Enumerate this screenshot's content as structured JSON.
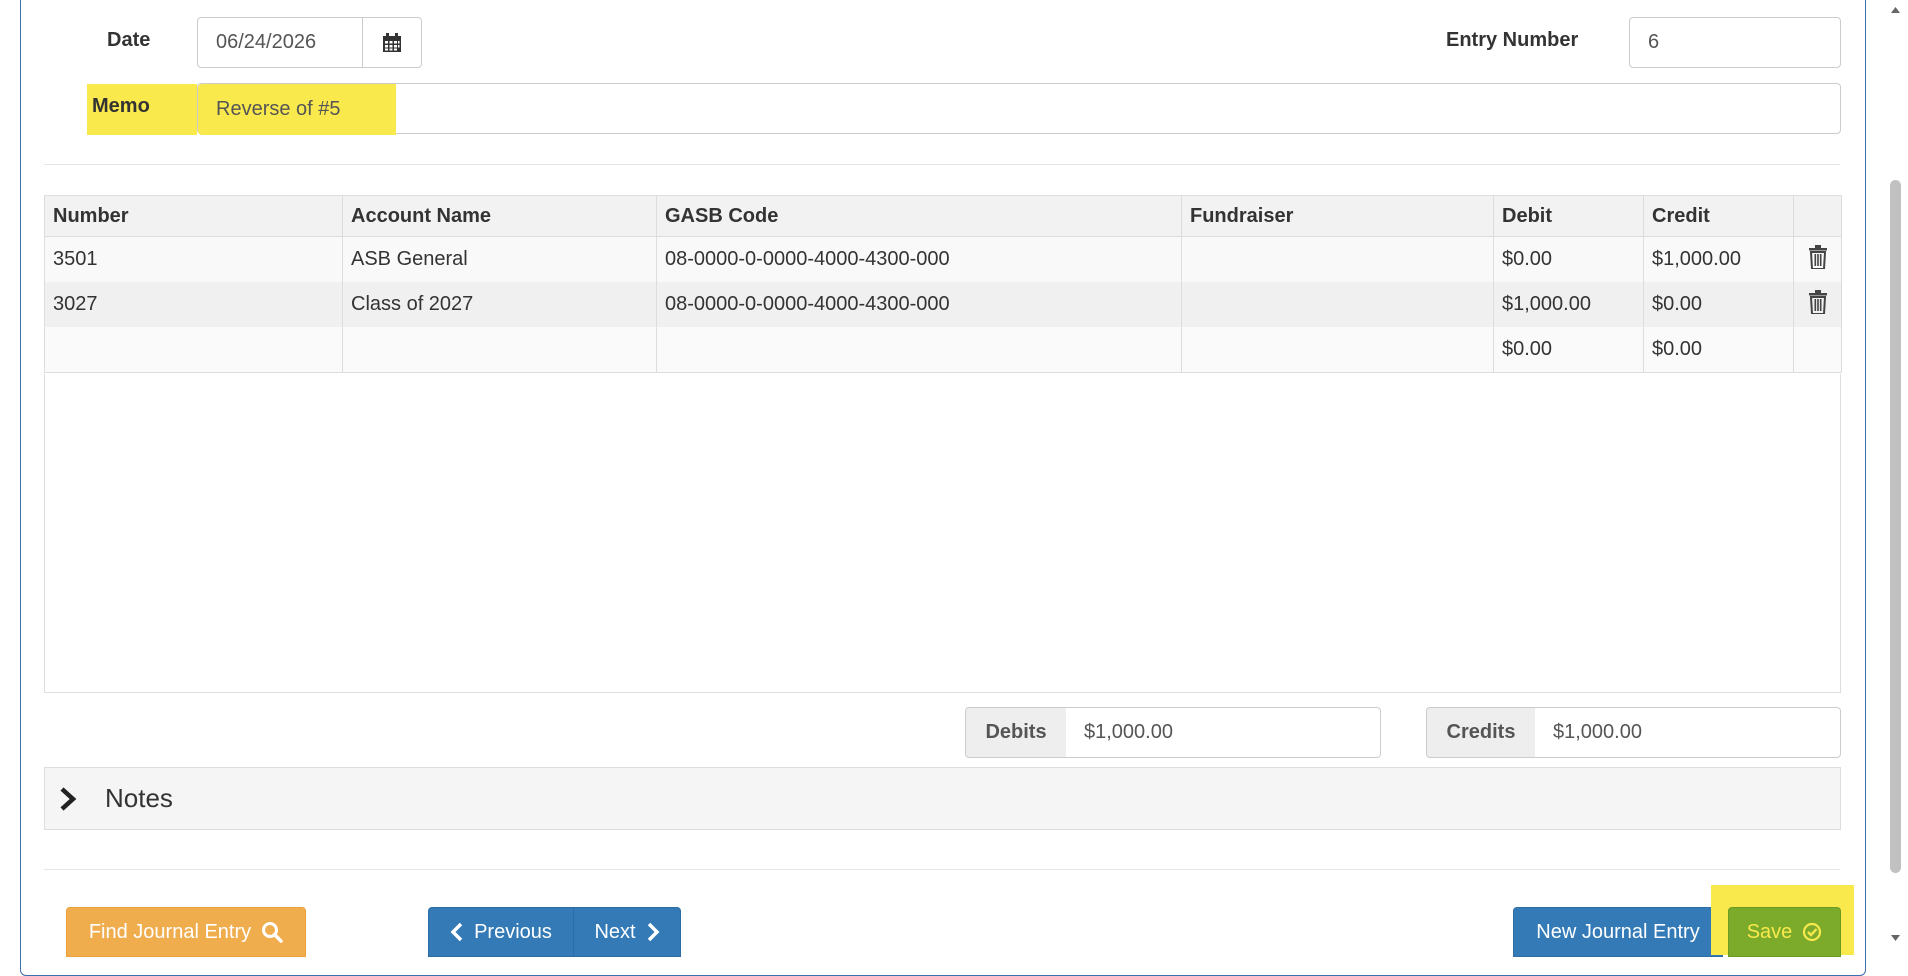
{
  "form": {
    "date_label": "Date",
    "date_value": "06/24/2026",
    "entry_number_label": "Entry Number",
    "entry_number_value": "6",
    "memo_label": "Memo",
    "memo_value": "Reverse of #5"
  },
  "table": {
    "headers": {
      "number": "Number",
      "account_name": "Account Name",
      "gasb_code": "GASB Code",
      "fundraiser": "Fundraiser",
      "debit": "Debit",
      "credit": "Credit"
    },
    "rows": [
      {
        "number": "3501",
        "account_name": "ASB General",
        "gasb_code": "08-0000-0-0000-4000-4300-000",
        "fundraiser": "",
        "debit": "$0.00",
        "credit": "$1,000.00"
      },
      {
        "number": "3027",
        "account_name": "Class of 2027",
        "gasb_code": "08-0000-0-0000-4000-4300-000",
        "fundraiser": "",
        "debit": "$1,000.00",
        "credit": "$0.00"
      }
    ],
    "blank_row": {
      "debit": "$0.00",
      "credit": "$0.00"
    }
  },
  "totals": {
    "debits_label": "Debits",
    "debits_value": "$1,000.00",
    "credits_label": "Credits",
    "credits_value": "$1,000.00"
  },
  "notes": {
    "label": "Notes"
  },
  "buttons": {
    "find": "Find Journal Entry",
    "previous": "Previous",
    "next": "Next",
    "new_entry": "New Journal Entry",
    "save": "Save"
  },
  "colors": {
    "highlight": "#f9e94c",
    "warning": "#f0ad4e",
    "primary": "#337ab7",
    "success": "#5cb85c"
  },
  "icons": {
    "calendar": "calendar-icon",
    "trash": "trash-icon",
    "search": "search-icon",
    "chevron_left": "chevron-left-icon",
    "chevron_right": "chevron-right-icon",
    "check_circle": "check-circle-icon"
  }
}
